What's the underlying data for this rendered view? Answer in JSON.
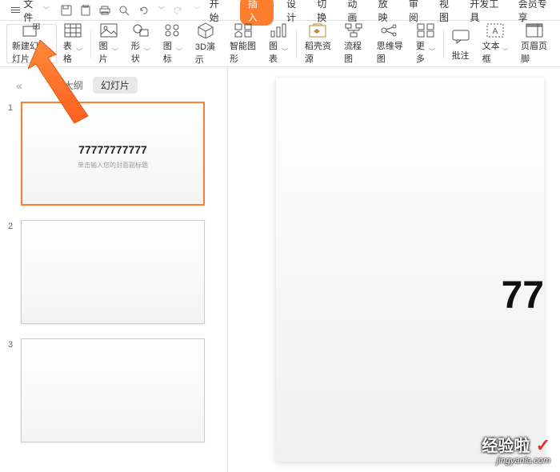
{
  "top": {
    "file_label": "文件",
    "tabs": {
      "start": "开始",
      "insert": "插入",
      "design": "设计",
      "switch": "切换",
      "animation": "动画",
      "play": "放映",
      "review": "审阅",
      "view": "视图",
      "devtools": "开发工具",
      "member": "会员专享"
    }
  },
  "ribbon": {
    "new_slide": "新建幻灯片",
    "table": "表格",
    "picture": "图片",
    "shape": "形状",
    "icon": "图标",
    "demo3d": "3D演示",
    "smartart": "智能图形",
    "chart": "图表",
    "resource": "稻壳资源",
    "flowchart": "流程图",
    "mindmap": "思维导图",
    "more": "更多",
    "comment": "批注",
    "textbox": "文本框",
    "header_footer": "页眉页脚"
  },
  "side": {
    "outline": "大纲",
    "slides": "幻灯片",
    "thumbs": [
      {
        "num": "1",
        "title": "77777777777",
        "sub": "单击输入您的封面副标题"
      },
      {
        "num": "2",
        "title": "",
        "sub": ""
      },
      {
        "num": "3",
        "title": "",
        "sub": ""
      }
    ]
  },
  "canvas": {
    "title": "77"
  },
  "watermark": {
    "main": "经验啦",
    "sub": "jingyanla.com"
  }
}
